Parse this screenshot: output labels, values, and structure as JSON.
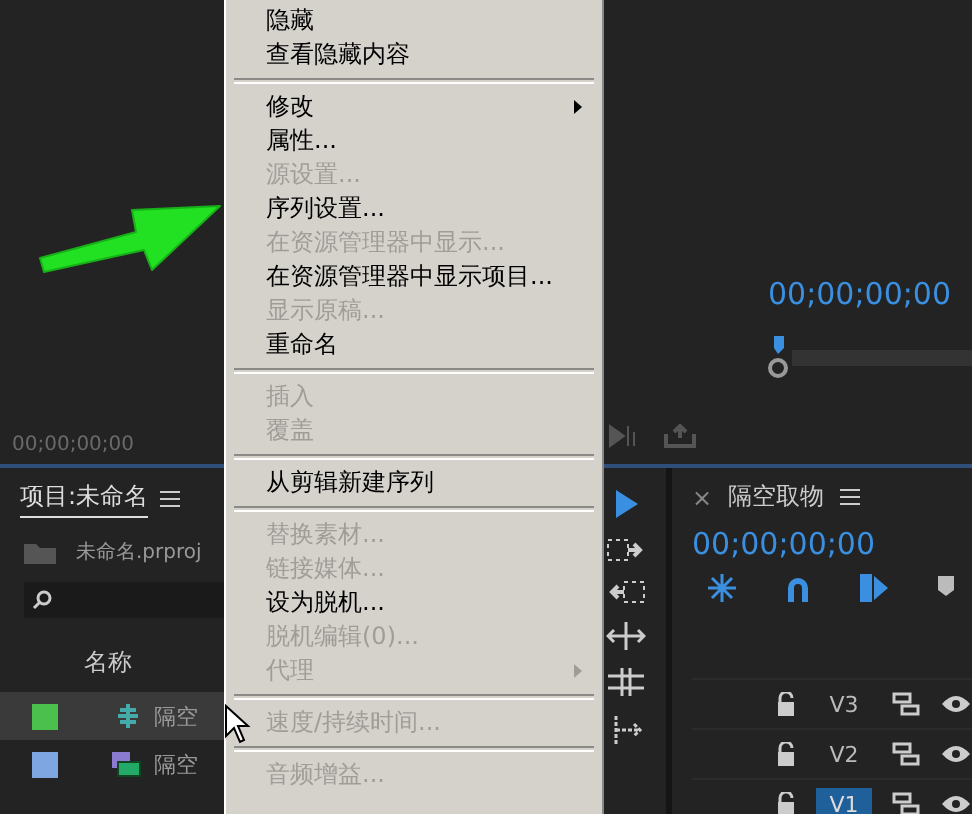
{
  "source_monitor": {
    "timecode": "00;00;00;00"
  },
  "program_monitor": {
    "timecode": "00;00;00;00"
  },
  "project_panel": {
    "title": "项目:未命名",
    "file": "未命名.prproj",
    "column": "名称",
    "rows": [
      {
        "name": "隔空",
        "color": "#4cc04c",
        "kind": "sequence",
        "selected": true
      },
      {
        "name": "隔空",
        "color": "#7ea6e0",
        "kind": "clip",
        "selected": false
      }
    ]
  },
  "timeline": {
    "close": "×",
    "tab": "隔空取物",
    "timecode": "00;00;00;00",
    "tracks": [
      {
        "label": "V3",
        "selected": false
      },
      {
        "label": "V2",
        "selected": false
      },
      {
        "label": "V1",
        "selected": true
      }
    ]
  },
  "context_menu": [
    {
      "kind": "item",
      "label": "隐藏",
      "disabled": false,
      "submenu": false
    },
    {
      "kind": "item",
      "label": "查看隐藏内容",
      "disabled": false,
      "submenu": false
    },
    {
      "kind": "separator"
    },
    {
      "kind": "item",
      "label": "修改",
      "disabled": false,
      "submenu": true
    },
    {
      "kind": "item",
      "label": "属性...",
      "disabled": false,
      "submenu": false
    },
    {
      "kind": "item",
      "label": "源设置...",
      "disabled": true,
      "submenu": false
    },
    {
      "kind": "item",
      "label": "序列设置...",
      "disabled": false,
      "submenu": false
    },
    {
      "kind": "item",
      "label": "在资源管理器中显示...",
      "disabled": true,
      "submenu": false
    },
    {
      "kind": "item",
      "label": "在资源管理器中显示项目...",
      "disabled": false,
      "submenu": false
    },
    {
      "kind": "item",
      "label": "显示原稿...",
      "disabled": true,
      "submenu": false
    },
    {
      "kind": "item",
      "label": "重命名",
      "disabled": false,
      "submenu": false
    },
    {
      "kind": "separator"
    },
    {
      "kind": "item",
      "label": "插入",
      "disabled": true,
      "submenu": false
    },
    {
      "kind": "item",
      "label": "覆盖",
      "disabled": true,
      "submenu": false
    },
    {
      "kind": "separator"
    },
    {
      "kind": "item",
      "label": "从剪辑新建序列",
      "disabled": false,
      "submenu": false
    },
    {
      "kind": "separator"
    },
    {
      "kind": "item",
      "label": "替换素材...",
      "disabled": true,
      "submenu": false
    },
    {
      "kind": "item",
      "label": "链接媒体...",
      "disabled": true,
      "submenu": false
    },
    {
      "kind": "item",
      "label": "设为脱机...",
      "disabled": false,
      "submenu": false
    },
    {
      "kind": "item",
      "label": "脱机编辑(0)...",
      "disabled": true,
      "submenu": false
    },
    {
      "kind": "item",
      "label": "代理",
      "disabled": true,
      "submenu": true
    },
    {
      "kind": "separator"
    },
    {
      "kind": "item",
      "label": "速度/持续时间...",
      "disabled": true,
      "submenu": false
    },
    {
      "kind": "separator"
    },
    {
      "kind": "item",
      "label": "音频增益...",
      "disabled": true,
      "submenu": false
    }
  ]
}
